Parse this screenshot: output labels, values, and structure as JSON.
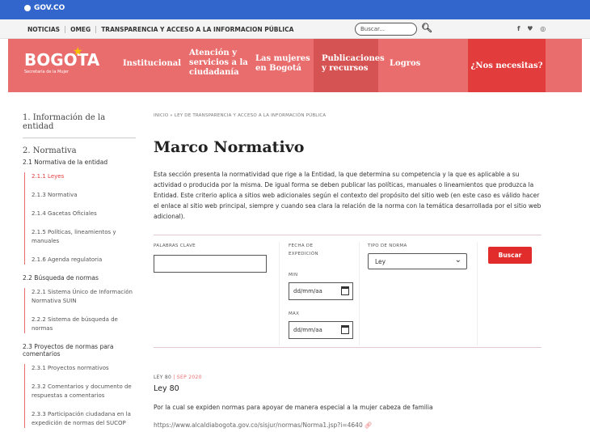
{
  "gov": {
    "label": "GOV.CO"
  },
  "topnav": {
    "links": [
      "NOTICIAS",
      "OMEG",
      "TRANSPARENCIA Y ACCESO A LA INFORMACION PÚBLICA"
    ],
    "search_placeholder": "Buscar...",
    "social": "f ♥ ◎"
  },
  "mainnav": {
    "brand": "BOGOTA",
    "brand_sub": "Secretaría de la Mujer",
    "items": [
      {
        "line1": "Institucional",
        "line2": "",
        "line3": ""
      },
      {
        "line1": "Atención y",
        "line2": "servicios a la",
        "line3": "ciudadanía"
      },
      {
        "line1": "Las mujeres",
        "line2": "en Bogotá",
        "line3": ""
      },
      {
        "line1": "Publicaciones",
        "line2": "y recursos",
        "line3": ""
      },
      {
        "line1": "Logros",
        "line2": "",
        "line3": ""
      }
    ],
    "help": "¿Nos necesitas?"
  },
  "sidebar": {
    "section1": "1. Información de la entidad",
    "section2": "2. Normativa",
    "group1": "2.1 Normativa de la entidad",
    "group1_items": [
      "2.1.1 Leyes",
      "2.1.3 Normativa",
      "2.1.4 Gacetas Oficiales",
      "2.1.5 Políticas, lineamientos y manuales",
      "2.1.6 Agenda regulatoria"
    ],
    "group2": "2.2 Búsqueda de normas",
    "group2_items": [
      "2.2.1 Sistema Único de Información Normativa SUIN",
      "2.2.2 Sistema de búsqueda de normas"
    ],
    "group3": "2.3 Proyectos de normas para comentarios",
    "group3_items": [
      "2.3.1 Proyectos normativos",
      "2.3.2 Comentarios y documento de respuestas a comentarios",
      "2.3.3 Participación ciudadana en la expedición de normas del SUCOP"
    ]
  },
  "content": {
    "breadcrumb": "INICIO » LEY DE TRANSPARENCIA Y ACCESO A LA INFORMACIÓN PÚBLICA",
    "title": "Marco Normativo",
    "description": "Esta sección presenta la normatividad que rige a la Entidad, la que determina su competencia y la que es aplicable a su actividad o producida por la misma. De igual forma se deben publicar las políticas, manuales o lineamientos que produzca la Entidad. Este criterio aplica a sitios web adicionales según el contexto del propósito del sitio web (en este caso es válido hacer el enlace al sitio web principal, siempre y cuando sea clara la relación de la norma con la temática desarrollada por el sitio web adicional)."
  },
  "filters": {
    "keywords_label": "PALABRAS CLAVE",
    "date_label_1": "FECHA DE",
    "date_label_2": "EXPEDICIÓN",
    "min_label": "MIN",
    "max_label": "MAX",
    "date_placeholder": "dd/mm/aa",
    "type_label": "TIPO DE NORMA",
    "type_value": "Ley",
    "search_button": "Buscar"
  },
  "result": {
    "type": "LEY 80",
    "sep": " | ",
    "date": "SEP 2020",
    "name": "Ley 80",
    "text": "Por la cual se expiden normas para apoyar de manera especial a la mujer cabeza de familia",
    "link": "https://www.alcaldiabogota.gov.co/sisjur/normas/Norma1.jsp?i=4640"
  }
}
